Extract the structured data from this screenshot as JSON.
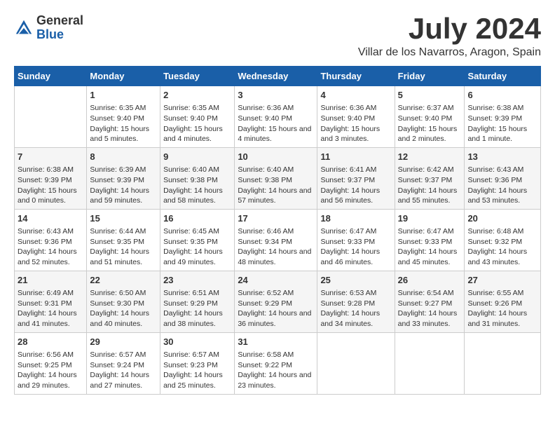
{
  "header": {
    "logo_general": "General",
    "logo_blue": "Blue",
    "month_title": "July 2024",
    "location": "Villar de los Navarros, Aragon, Spain"
  },
  "weekdays": [
    "Sunday",
    "Monday",
    "Tuesday",
    "Wednesday",
    "Thursday",
    "Friday",
    "Saturday"
  ],
  "weeks": [
    [
      {
        "day": "",
        "sunrise": "",
        "sunset": "",
        "daylight": ""
      },
      {
        "day": "1",
        "sunrise": "Sunrise: 6:35 AM",
        "sunset": "Sunset: 9:40 PM",
        "daylight": "Daylight: 15 hours and 5 minutes."
      },
      {
        "day": "2",
        "sunrise": "Sunrise: 6:35 AM",
        "sunset": "Sunset: 9:40 PM",
        "daylight": "Daylight: 15 hours and 4 minutes."
      },
      {
        "day": "3",
        "sunrise": "Sunrise: 6:36 AM",
        "sunset": "Sunset: 9:40 PM",
        "daylight": "Daylight: 15 hours and 4 minutes."
      },
      {
        "day": "4",
        "sunrise": "Sunrise: 6:36 AM",
        "sunset": "Sunset: 9:40 PM",
        "daylight": "Daylight: 15 hours and 3 minutes."
      },
      {
        "day": "5",
        "sunrise": "Sunrise: 6:37 AM",
        "sunset": "Sunset: 9:40 PM",
        "daylight": "Daylight: 15 hours and 2 minutes."
      },
      {
        "day": "6",
        "sunrise": "Sunrise: 6:38 AM",
        "sunset": "Sunset: 9:39 PM",
        "daylight": "Daylight: 15 hours and 1 minute."
      }
    ],
    [
      {
        "day": "7",
        "sunrise": "Sunrise: 6:38 AM",
        "sunset": "Sunset: 9:39 PM",
        "daylight": "Daylight: 15 hours and 0 minutes."
      },
      {
        "day": "8",
        "sunrise": "Sunrise: 6:39 AM",
        "sunset": "Sunset: 9:39 PM",
        "daylight": "Daylight: 14 hours and 59 minutes."
      },
      {
        "day": "9",
        "sunrise": "Sunrise: 6:40 AM",
        "sunset": "Sunset: 9:38 PM",
        "daylight": "Daylight: 14 hours and 58 minutes."
      },
      {
        "day": "10",
        "sunrise": "Sunrise: 6:40 AM",
        "sunset": "Sunset: 9:38 PM",
        "daylight": "Daylight: 14 hours and 57 minutes."
      },
      {
        "day": "11",
        "sunrise": "Sunrise: 6:41 AM",
        "sunset": "Sunset: 9:37 PM",
        "daylight": "Daylight: 14 hours and 56 minutes."
      },
      {
        "day": "12",
        "sunrise": "Sunrise: 6:42 AM",
        "sunset": "Sunset: 9:37 PM",
        "daylight": "Daylight: 14 hours and 55 minutes."
      },
      {
        "day": "13",
        "sunrise": "Sunrise: 6:43 AM",
        "sunset": "Sunset: 9:36 PM",
        "daylight": "Daylight: 14 hours and 53 minutes."
      }
    ],
    [
      {
        "day": "14",
        "sunrise": "Sunrise: 6:43 AM",
        "sunset": "Sunset: 9:36 PM",
        "daylight": "Daylight: 14 hours and 52 minutes."
      },
      {
        "day": "15",
        "sunrise": "Sunrise: 6:44 AM",
        "sunset": "Sunset: 9:35 PM",
        "daylight": "Daylight: 14 hours and 51 minutes."
      },
      {
        "day": "16",
        "sunrise": "Sunrise: 6:45 AM",
        "sunset": "Sunset: 9:35 PM",
        "daylight": "Daylight: 14 hours and 49 minutes."
      },
      {
        "day": "17",
        "sunrise": "Sunrise: 6:46 AM",
        "sunset": "Sunset: 9:34 PM",
        "daylight": "Daylight: 14 hours and 48 minutes."
      },
      {
        "day": "18",
        "sunrise": "Sunrise: 6:47 AM",
        "sunset": "Sunset: 9:33 PM",
        "daylight": "Daylight: 14 hours and 46 minutes."
      },
      {
        "day": "19",
        "sunrise": "Sunrise: 6:47 AM",
        "sunset": "Sunset: 9:33 PM",
        "daylight": "Daylight: 14 hours and 45 minutes."
      },
      {
        "day": "20",
        "sunrise": "Sunrise: 6:48 AM",
        "sunset": "Sunset: 9:32 PM",
        "daylight": "Daylight: 14 hours and 43 minutes."
      }
    ],
    [
      {
        "day": "21",
        "sunrise": "Sunrise: 6:49 AM",
        "sunset": "Sunset: 9:31 PM",
        "daylight": "Daylight: 14 hours and 41 minutes."
      },
      {
        "day": "22",
        "sunrise": "Sunrise: 6:50 AM",
        "sunset": "Sunset: 9:30 PM",
        "daylight": "Daylight: 14 hours and 40 minutes."
      },
      {
        "day": "23",
        "sunrise": "Sunrise: 6:51 AM",
        "sunset": "Sunset: 9:29 PM",
        "daylight": "Daylight: 14 hours and 38 minutes."
      },
      {
        "day": "24",
        "sunrise": "Sunrise: 6:52 AM",
        "sunset": "Sunset: 9:29 PM",
        "daylight": "Daylight: 14 hours and 36 minutes."
      },
      {
        "day": "25",
        "sunrise": "Sunrise: 6:53 AM",
        "sunset": "Sunset: 9:28 PM",
        "daylight": "Daylight: 14 hours and 34 minutes."
      },
      {
        "day": "26",
        "sunrise": "Sunrise: 6:54 AM",
        "sunset": "Sunset: 9:27 PM",
        "daylight": "Daylight: 14 hours and 33 minutes."
      },
      {
        "day": "27",
        "sunrise": "Sunrise: 6:55 AM",
        "sunset": "Sunset: 9:26 PM",
        "daylight": "Daylight: 14 hours and 31 minutes."
      }
    ],
    [
      {
        "day": "28",
        "sunrise": "Sunrise: 6:56 AM",
        "sunset": "Sunset: 9:25 PM",
        "daylight": "Daylight: 14 hours and 29 minutes."
      },
      {
        "day": "29",
        "sunrise": "Sunrise: 6:57 AM",
        "sunset": "Sunset: 9:24 PM",
        "daylight": "Daylight: 14 hours and 27 minutes."
      },
      {
        "day": "30",
        "sunrise": "Sunrise: 6:57 AM",
        "sunset": "Sunset: 9:23 PM",
        "daylight": "Daylight: 14 hours and 25 minutes."
      },
      {
        "day": "31",
        "sunrise": "Sunrise: 6:58 AM",
        "sunset": "Sunset: 9:22 PM",
        "daylight": "Daylight: 14 hours and 23 minutes."
      },
      {
        "day": "",
        "sunrise": "",
        "sunset": "",
        "daylight": ""
      },
      {
        "day": "",
        "sunrise": "",
        "sunset": "",
        "daylight": ""
      },
      {
        "day": "",
        "sunrise": "",
        "sunset": "",
        "daylight": ""
      }
    ]
  ]
}
